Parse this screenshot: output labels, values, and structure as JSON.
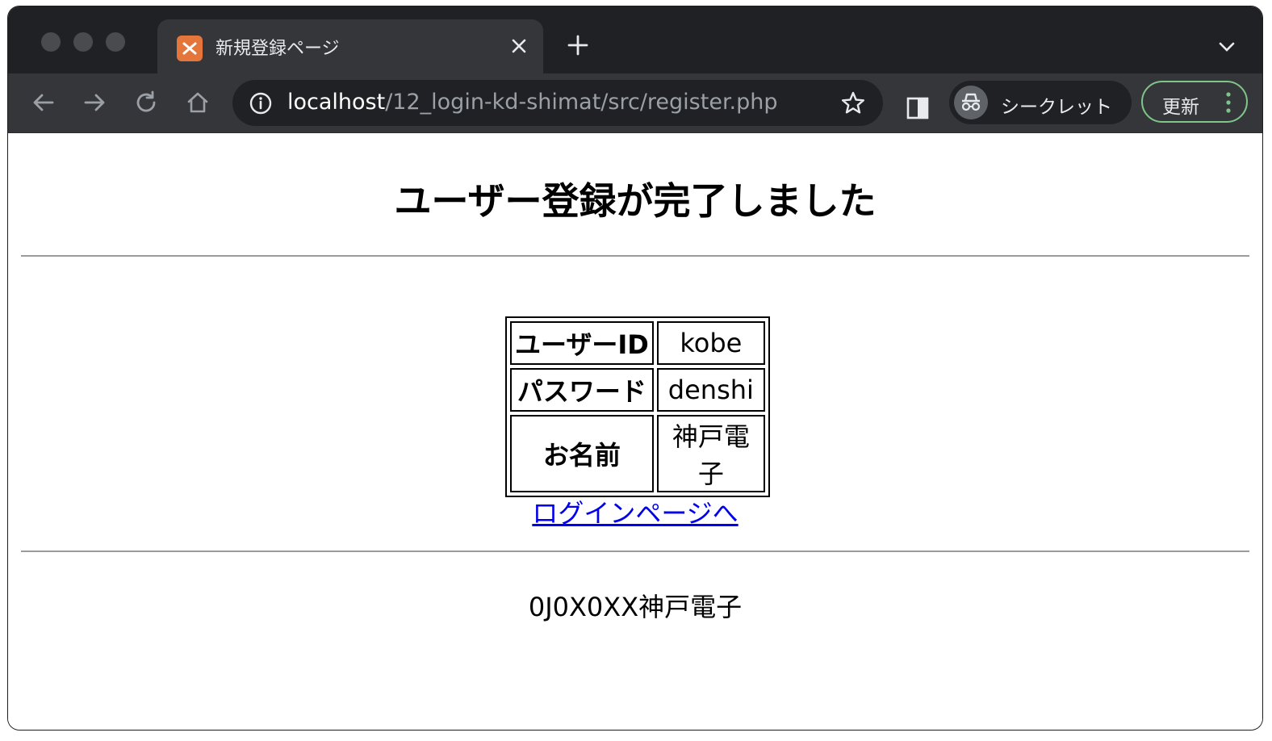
{
  "browser": {
    "tab_title": "新規登録ページ",
    "url_host": "localhost",
    "url_path": "/12_login-kd-shimat/src/register.php",
    "incognito_label": "シークレット",
    "update_label": "更新",
    "favicon_color": "#e5763b",
    "update_border_color": "#7fc58a"
  },
  "page": {
    "title": "ユーザー登録が完了しました",
    "table": [
      {
        "label": "ユーザーID",
        "value": "kobe"
      },
      {
        "label": "パスワード",
        "value": "denshi"
      },
      {
        "label": "お名前",
        "value": "神戸電子"
      }
    ],
    "login_link": "ログインページへ",
    "footer": "0J0X0XX神戸電子",
    "link_color": "#0000ee"
  }
}
